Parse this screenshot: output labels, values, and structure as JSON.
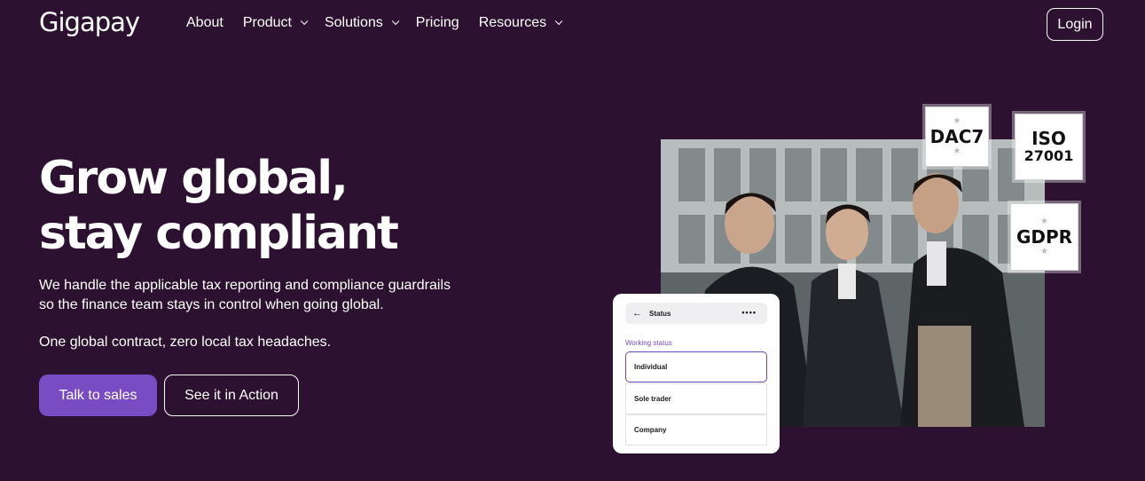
{
  "brand": {
    "logo": "Gigapay"
  },
  "nav": {
    "items": [
      {
        "label": "About",
        "dropdown": false
      },
      {
        "label": "Product",
        "dropdown": true
      },
      {
        "label": "Solutions",
        "dropdown": true
      },
      {
        "label": "Pricing",
        "dropdown": false
      },
      {
        "label": "Resources",
        "dropdown": true
      }
    ],
    "login_label": "Login"
  },
  "hero": {
    "title_line1": "Grow global,",
    "title_line2": "stay compliant",
    "description": "We handle the applicable tax reporting and compliance guardrails so the finance team stays in control when going global.",
    "tagline": "One global contract, zero local tax headaches.",
    "cta_primary": "Talk to sales",
    "cta_secondary": "See it in Action"
  },
  "badges": {
    "dac7": "DAC7",
    "iso_line1": "ISO",
    "iso_line2": "27001",
    "gdpr": "GDPR"
  },
  "status_card": {
    "title": "Status",
    "field_label": "Working status",
    "options": [
      "Individual",
      "Sole trader",
      "Company"
    ],
    "selected": "Individual"
  },
  "colors": {
    "background": "#2d1130",
    "accent": "#7a4cc4",
    "text": "#ffffff"
  }
}
